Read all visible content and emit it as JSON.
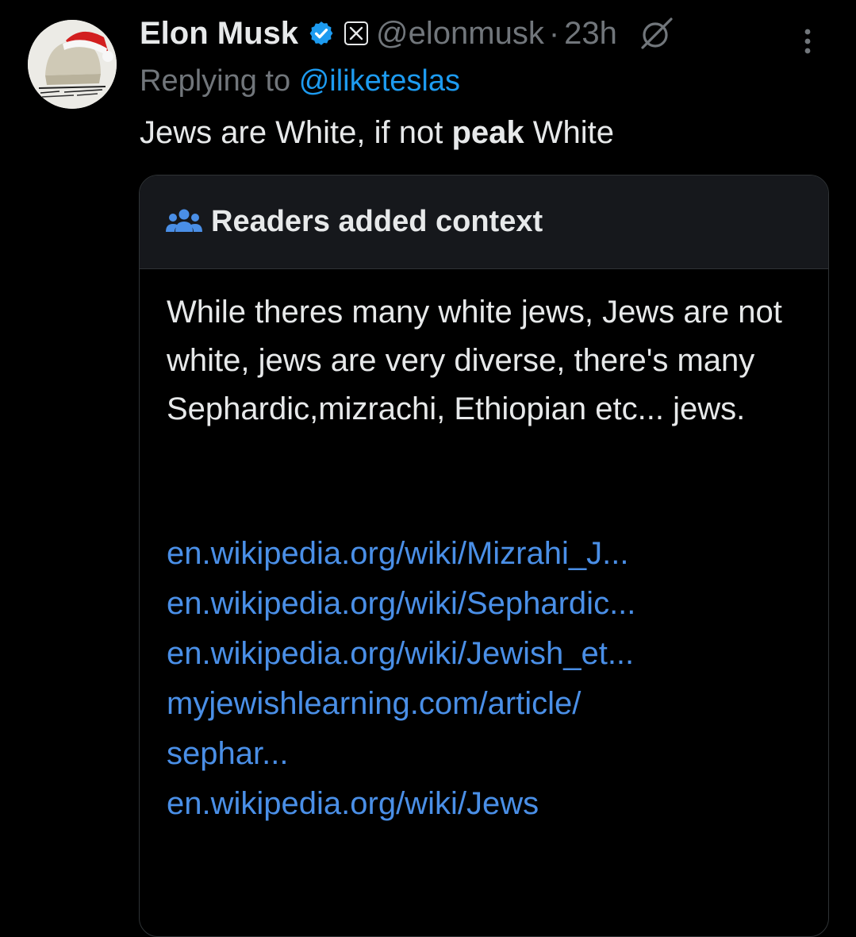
{
  "tweet": {
    "author": {
      "display_name": "Elon Musk",
      "handle": "@elonmusk",
      "verified_color": "#1d9bf0"
    },
    "time_separator": "·",
    "time": "23h",
    "reply": {
      "prefix": "Replying to",
      "mention": "@iliketeslas"
    },
    "text": {
      "before": "Jews are White, if not",
      "bold": "peak",
      "after": "White"
    }
  },
  "community_note": {
    "title": "Readers added context",
    "body": "While theres many white jews, Jews are not white, jews are very diverse, there's many Sephardic,mizrachi, Ethiopian etc... jews.",
    "links": [
      "en.wikipedia.org/wiki/Mizrahi_J...",
      "en.wikipedia.org/wiki/Sephardic...",
      "en.wikipedia.org/wiki/Jewish_et...",
      "myjewishlearning.com/article/",
      "sephar...",
      "en.wikipedia.org/wiki/Jews"
    ],
    "link_color": "#4a8fe7"
  },
  "icons": {
    "verified": "verified-badge-icon",
    "affiliate": "x-affiliate-icon",
    "grok": "grok-icon",
    "more": "more-icon",
    "people": "people-icon"
  }
}
